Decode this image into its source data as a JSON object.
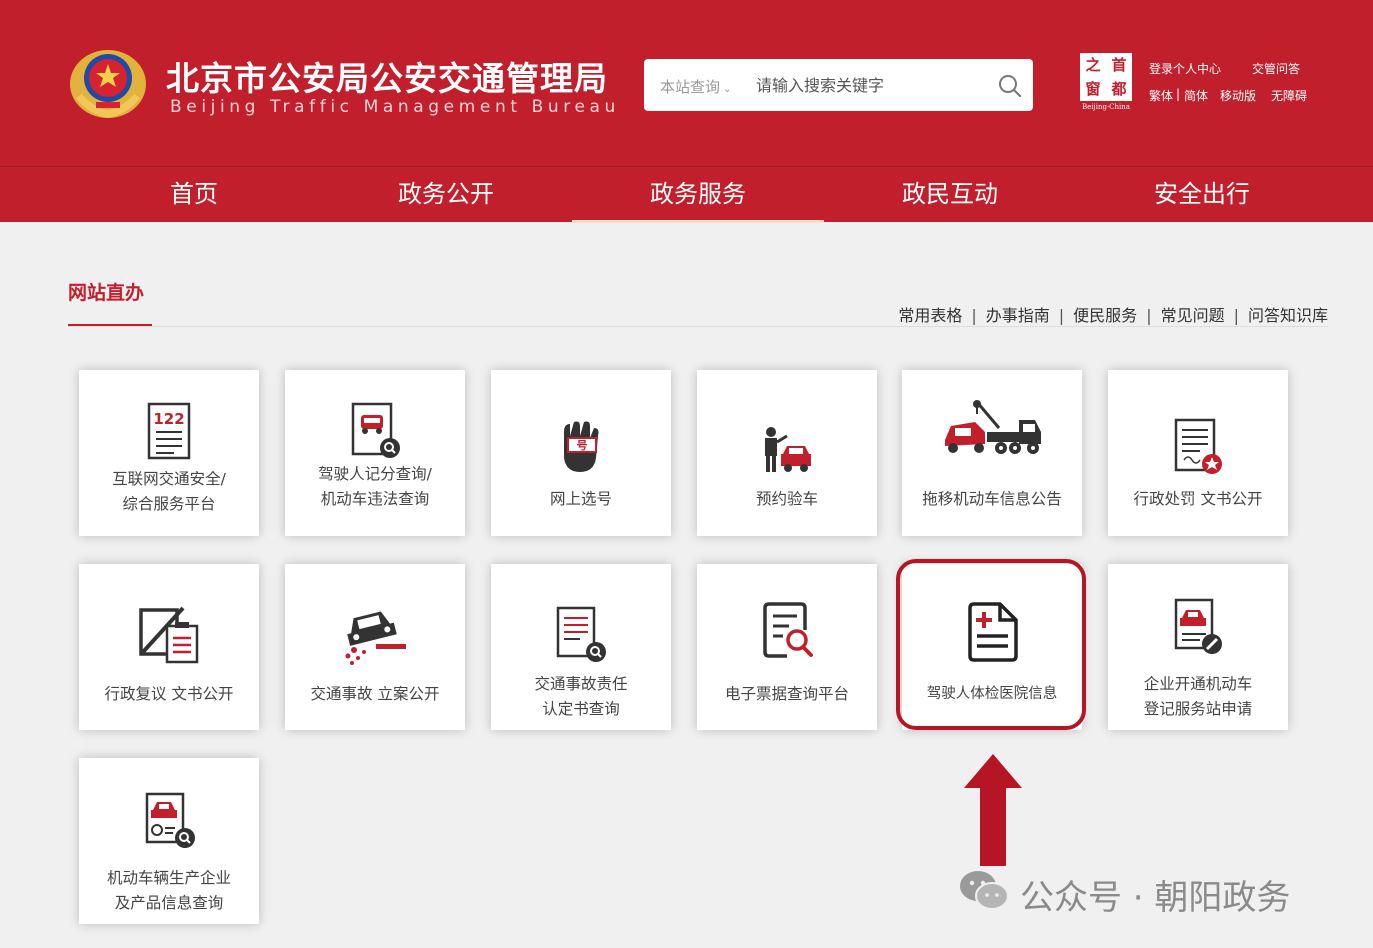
{
  "header": {
    "title": "北京市公安局公安交通管理局",
    "subtitle": "Beijing Traffic Management Bureau",
    "search": {
      "scope_label": "本站查询",
      "placeholder": "请输入搜索关键字"
    },
    "capital_logo": {
      "chars": [
        "之",
        "首",
        "窗",
        "都"
      ],
      "caption": "Beijing·China"
    },
    "links": {
      "login": "登录个人中心",
      "qa": "交管问答",
      "traditional": "繁体",
      "divider": "|",
      "simplified": "简体",
      "mobile": "移动版",
      "accessibility": "无障碍"
    }
  },
  "nav": [
    {
      "label": "首页",
      "active": false
    },
    {
      "label": "政务公开",
      "active": false
    },
    {
      "label": "政务服务",
      "active": true
    },
    {
      "label": "政民互动",
      "active": false
    },
    {
      "label": "安全出行",
      "active": false
    }
  ],
  "section": {
    "title": "网站直办",
    "separator": "|",
    "quick_links": [
      "常用表格",
      "办事指南",
      "便民服务",
      "常见问题",
      "问答知识库"
    ]
  },
  "tiles": [
    {
      "lines": [
        "互联网交通安全/",
        "综合服务平台"
      ],
      "icon": "122-document-icon"
    },
    {
      "lines": [
        "驾驶人记分查询/",
        "机动车违法查询"
      ],
      "icon": "car-search-icon"
    },
    {
      "lines": [
        "网上选号"
      ],
      "icon": "hand-number-icon"
    },
    {
      "lines": [
        "预约验车"
      ],
      "icon": "inspector-car-icon"
    },
    {
      "lines": [
        "拖移机动车信息公告"
      ],
      "icon": "tow-truck-icon"
    },
    {
      "lines": [
        "行政处罚 文书公开"
      ],
      "icon": "penalty-document-icon"
    },
    {
      "lines": [
        "行政复议 文书公开"
      ],
      "icon": "review-document-icon"
    },
    {
      "lines": [
        "交通事故 立案公开"
      ],
      "icon": "accident-car-icon"
    },
    {
      "lines": [
        "交通事故责任",
        "认定书查询"
      ],
      "icon": "report-search-icon"
    },
    {
      "lines": [
        "电子票据查询平台"
      ],
      "icon": "receipt-search-icon"
    },
    {
      "lines": [
        "驾驶人体检医院信息"
      ],
      "icon": "medical-document-icon",
      "highlighted": true
    },
    {
      "lines": [
        "企业开通机动车",
        "登记服务站申请"
      ],
      "icon": "car-register-icon"
    },
    {
      "lines": [
        "机动车辆生产企业",
        "及产品信息查询"
      ],
      "icon": "car-product-search-icon"
    }
  ],
  "watermark": {
    "text": "公众号 · 朝阳政务"
  },
  "colors": {
    "brand_red": "#c21f2d",
    "highlight_red": "#b51524",
    "icon_dark": "#333333"
  }
}
